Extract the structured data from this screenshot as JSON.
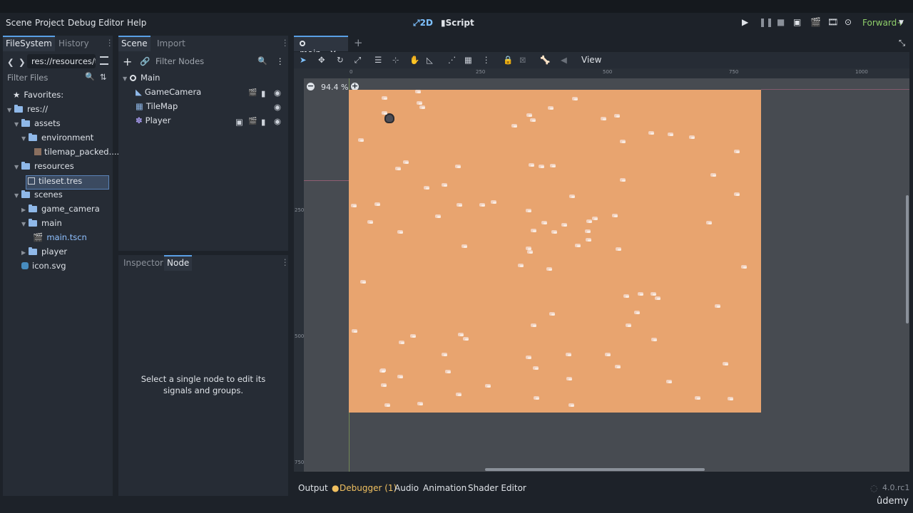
{
  "menubar": {
    "items": [
      "Scene",
      "Project",
      "Debug",
      "Editor",
      "Help"
    ],
    "workspace": {
      "btn_2d": "2D",
      "btn_script": "Script"
    },
    "renderer": "Forward+"
  },
  "filesystem": {
    "tabs": [
      "FileSystem",
      "History"
    ],
    "path": "res://resources/til",
    "filter_placeholder": "Filter Files",
    "tree": {
      "favorites": "Favorites:",
      "root": "res://",
      "assets": "assets",
      "environment": "environment",
      "tilemap_file": "tilemap_packed....",
      "resources": "resources",
      "tileset_file": "tileset.tres",
      "scenes": "scenes",
      "game_camera": "game_camera",
      "main_folder": "main",
      "main_scene": "main.tscn",
      "player": "player",
      "icon": "icon.svg"
    }
  },
  "scene_dock": {
    "tabs": [
      "Scene",
      "Import"
    ],
    "filter_placeholder": "Filter Nodes",
    "nodes": {
      "main": "Main",
      "camera": "GameCamera",
      "tilemap": "TileMap",
      "player": "Player"
    }
  },
  "inspector_dock": {
    "tabs": [
      "Inspector",
      "Node"
    ],
    "message": "Select a single node to edit its signals and groups."
  },
  "editor": {
    "tab": "main",
    "zoom": "94.4 %",
    "view_menu": "View",
    "ruler_h": [
      "0",
      "250",
      "500",
      "750",
      "1000"
    ],
    "ruler_v": [
      "250",
      "500",
      "750"
    ]
  },
  "bottom": {
    "tabs": [
      "Output",
      "Debugger (1)",
      "Audio",
      "Animation",
      "Shader Editor"
    ],
    "version": "4.0.rc1"
  },
  "watermark": "ûdemy",
  "colors": {
    "accent": "#5aa0e6",
    "ground": "#e8a46f",
    "viewport_bg": "#474b51"
  }
}
